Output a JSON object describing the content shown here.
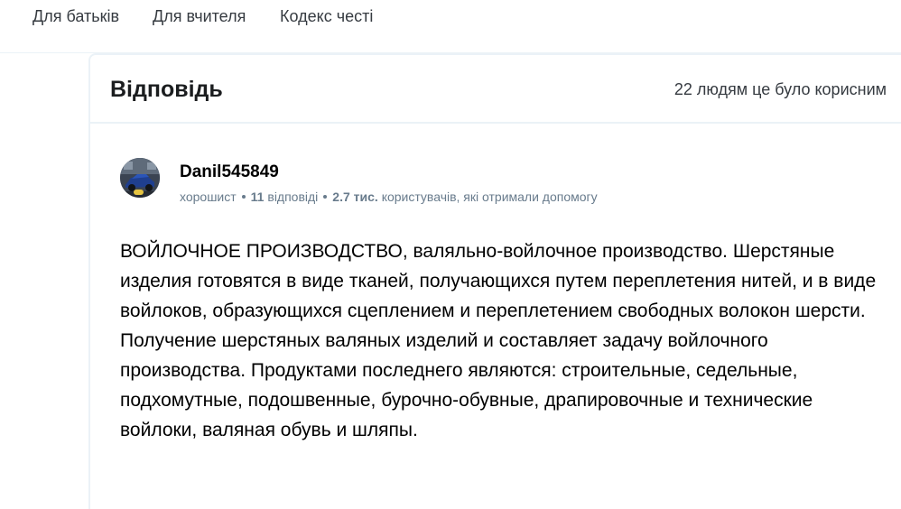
{
  "nav": {
    "links": [
      "Для батьків",
      "Для вчителя",
      "Кодекс честі"
    ]
  },
  "answer": {
    "title": "Відповідь",
    "helpful": "22 людям це було корисним",
    "author": {
      "name": "Danil545849",
      "rank": "хорошист",
      "answers_count": "11",
      "answers_label": "відповіді",
      "helped_count": "2.7 тис.",
      "helped_label": "користувачів, які отримали допомогу"
    },
    "text": "ВОЙЛОЧНОЕ ПРОИЗВОДСТВО, валяльно-войлочное производство. Шерстяные изделия готовятся в виде тканей, получающихся путем переплетения нитей, и в виде войлоков, образующихся сцеплением и переплетением свободных волокон шерсти. Получение шерстяных валяных изделий и составляет задачу войлочного производства. Продуктами последнего являются: строительные, седельные, подхомутные, подошвенные, бурочно-обувные, драпировочные и технические войлоки, валяная обувь и шляпы."
  },
  "colors": {
    "nav_text": "#363b41",
    "border": "#ebf2f7",
    "meta_text": "#687b8c",
    "badge": "#e6c542"
  }
}
